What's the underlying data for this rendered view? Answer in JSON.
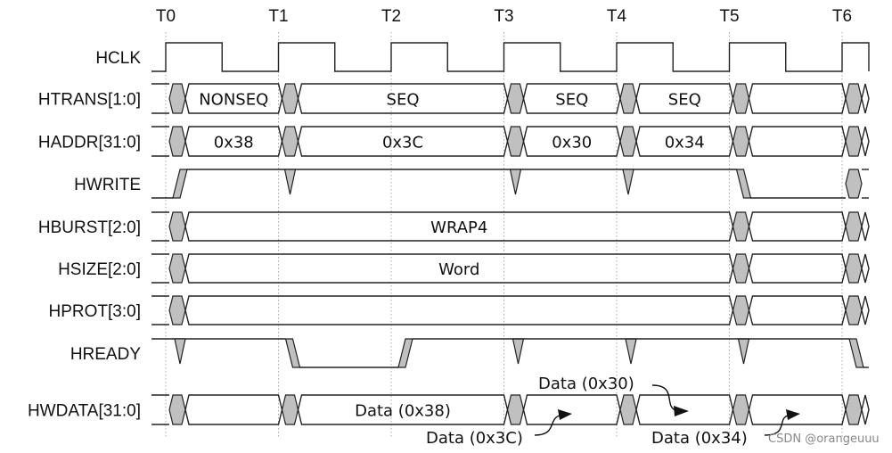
{
  "time_markers": [
    "T0",
    "T1",
    "T2",
    "T3",
    "T4",
    "T5",
    "T6"
  ],
  "signals": [
    {
      "name": "HCLK",
      "kind": "clock"
    },
    {
      "name": "HTRANS[1:0]",
      "kind": "bus",
      "transitions": [
        0,
        1,
        3,
        4,
        5,
        6
      ],
      "values": [
        "NONSEQ",
        "SEQ",
        "SEQ",
        "SEQ",
        ""
      ]
    },
    {
      "name": "HADDR[31:0]",
      "kind": "bus",
      "transitions": [
        0,
        1,
        3,
        4,
        5,
        6
      ],
      "values": [
        "0x38",
        "0x3C",
        "0x30",
        "0x34",
        ""
      ]
    },
    {
      "name": "HWRITE",
      "kind": "write"
    },
    {
      "name": "HBURST[2:0]",
      "kind": "bus",
      "transitions": [
        0,
        5,
        6
      ],
      "values": [
        "WRAP4",
        ""
      ]
    },
    {
      "name": "HSIZE[2:0]",
      "kind": "bus",
      "transitions": [
        0,
        5,
        6
      ],
      "values": [
        "Word",
        ""
      ]
    },
    {
      "name": "HPROT[3:0]",
      "kind": "bus",
      "transitions": [
        0,
        5,
        6
      ],
      "values": [
        "",
        ""
      ]
    },
    {
      "name": "HREADY",
      "kind": "ready"
    },
    {
      "name": "HWDATA[31:0]",
      "kind": "bus",
      "transitions": [
        0,
        1,
        3,
        4,
        5,
        6
      ],
      "values": [
        "",
        "Data (0x38)",
        "",
        "",
        ""
      ]
    }
  ],
  "annotations": {
    "data_3c": "Data (0x3C)",
    "data_30": "Data (0x30)",
    "data_34": "Data (0x34)"
  },
  "watermark": "CSDN @orangeuuu",
  "colors": {
    "line": "#222222",
    "transition_fill": "#c0c0c0",
    "grid": "#aaaaaa"
  }
}
